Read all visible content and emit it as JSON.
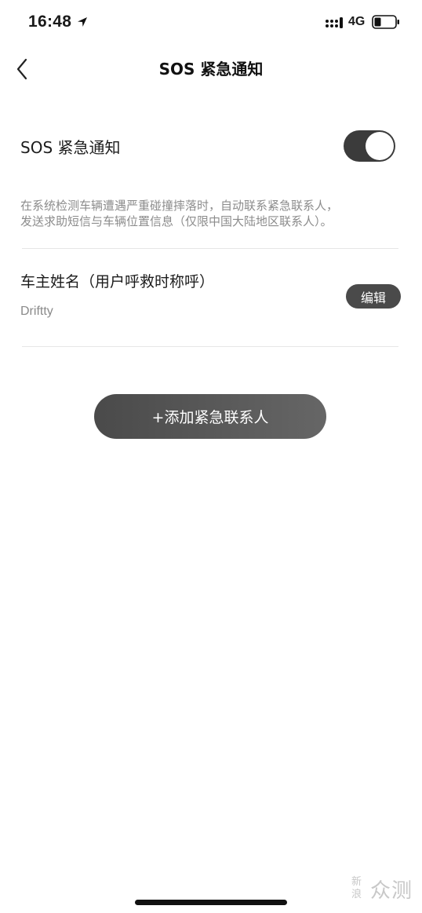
{
  "status_bar": {
    "time": "16:48",
    "network": "4G",
    "icons": [
      "location-arrow-icon",
      "signal-icon",
      "battery-icon"
    ]
  },
  "nav": {
    "title": "SOS 紧急通知",
    "back_icon": "chevron-left-icon"
  },
  "sos": {
    "label": "SOS 紧急通知",
    "toggle_on": true,
    "description_line1": "在系统检测车辆遭遇严重碰撞摔落时，自动联系紧急联系人，",
    "description_line2": "发送求助短信与车辆位置信息（仅限中国大陆地区联系人）。"
  },
  "owner": {
    "label": "车主姓名（用户呼救时称呼）",
    "value": "Driftty",
    "edit_label": "编辑"
  },
  "actions": {
    "add_contact_label": "+添加紧急联系人"
  },
  "watermark": {
    "small_text": "新浪",
    "large_text": "众测"
  },
  "colors": {
    "toggle_on": "#3b3b3b",
    "button_dark": "#4a4a4a",
    "muted_text": "#8c8c8c",
    "divider": "#e6e6e6"
  }
}
